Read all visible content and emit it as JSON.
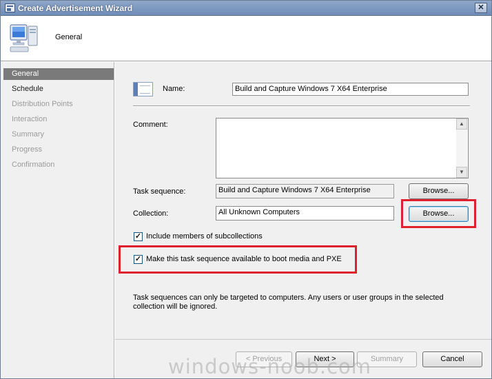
{
  "window": {
    "title": "Create Advertisement Wizard",
    "close_glyph": "✕"
  },
  "header": {
    "title": "General"
  },
  "nav": {
    "items": [
      {
        "label": "General"
      },
      {
        "label": "Schedule"
      },
      {
        "label": "Distribution Points"
      },
      {
        "label": "Interaction"
      },
      {
        "label": "Summary"
      },
      {
        "label": "Progress"
      },
      {
        "label": "Confirmation"
      }
    ],
    "active_index": 0
  },
  "form": {
    "name_label": "Name:",
    "name_value": "Build and Capture Windows 7 X64 Enterprise",
    "comment_label": "Comment:",
    "comment_value": "",
    "task_sequence_label": "Task sequence:",
    "task_sequence_value": "Build and Capture Windows 7 X64 Enterprise",
    "task_sequence_browse": "Browse...",
    "collection_label": "Collection:",
    "collection_value": "All Unknown Computers",
    "collection_browse": "Browse...",
    "include_subcollections_label": "Include members of subcollections",
    "include_subcollections_checked": true,
    "boot_media_label": "Make this task sequence available to boot media and PXE",
    "boot_media_checked": true,
    "check_glyph": "✓",
    "note": "Task sequences can only be targeted to computers.  Any users or user groups in the selected collection will be ignored."
  },
  "footer": {
    "previous": "< Previous",
    "next": "Next >",
    "summary": "Summary",
    "cancel": "Cancel"
  },
  "watermark": "windows-noob.com",
  "colors": {
    "highlight": "#e0202c",
    "nav_active": "#7a7a7a"
  }
}
